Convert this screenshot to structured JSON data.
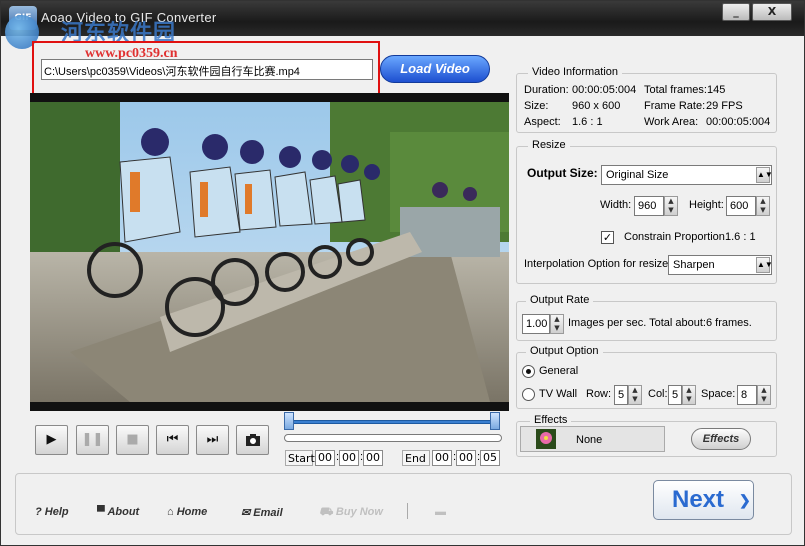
{
  "window": {
    "title": "Aoao Video to GIF Converter",
    "app_icon": "GIF",
    "minimize_label": "_",
    "close_label": "X"
  },
  "watermark": {
    "text": "河东软件园",
    "url": "www.pc0359.cn"
  },
  "file": {
    "path": "C:\\Users\\pc0359\\Videos\\河东软件园自行车比赛.mp4",
    "load_label": "Load Video"
  },
  "player": {
    "controls": [
      {
        "name": "play-button",
        "icon": "▶",
        "enabled": true
      },
      {
        "name": "pause-button",
        "icon": "❚❚",
        "enabled": false
      },
      {
        "name": "stop-button",
        "icon": "■",
        "enabled": false
      },
      {
        "name": "prev-frame-button",
        "icon": "⏮",
        "enabled": true
      },
      {
        "name": "next-frame-button",
        "icon": "⏭",
        "enabled": true
      },
      {
        "name": "snapshot-button",
        "icon": "camera-icon",
        "enabled": true
      }
    ],
    "start_label": "Start",
    "end_label": "End",
    "start_time": [
      "00",
      "00",
      "00"
    ],
    "end_time": [
      "00",
      "00",
      "05"
    ]
  },
  "video_info": {
    "title": "Video Information",
    "duration_label": "Duration:",
    "duration": "00:00:05:004",
    "total_frames_label": "Total frames:",
    "total_frames": "145",
    "size_label": "Size:",
    "size": "960 x 600",
    "frame_rate_label": "Frame Rate:",
    "frame_rate": "29 FPS",
    "aspect_label": "Aspect:",
    "aspect": "1.6 : 1",
    "work_area_label": "Work Area:",
    "work_area": "00:00:05:004"
  },
  "resize": {
    "title": "Resize",
    "output_size_label": "Output Size:",
    "output_size": "Original Size",
    "width_label": "Width:",
    "width": "960",
    "height_label": "Height:",
    "height": "600",
    "constrain_label": "Constrain Proportion",
    "constrain_value": "1.6 : 1",
    "constrain_checked": true,
    "interp_label": "Interpolation Option for resize:",
    "interp": "Sharpen"
  },
  "output_rate": {
    "title": "Output Rate",
    "value": "1.00",
    "text": "Images per sec. Total about:6 frames."
  },
  "output_option": {
    "title": "Output Option",
    "general_label": "General",
    "general_selected": true,
    "tvwall_label": "TV Wall",
    "row_label": "Row:",
    "row": "5",
    "col_label": "Col:",
    "col": "5",
    "space_label": "Space:",
    "space": "8"
  },
  "effects": {
    "title": "Effects",
    "value": "None",
    "button_label": "Effects"
  },
  "bottom": {
    "help": "Help",
    "about": "About",
    "home": "Home",
    "email": "Email",
    "buy": "Buy Now",
    "next": "Next"
  }
}
